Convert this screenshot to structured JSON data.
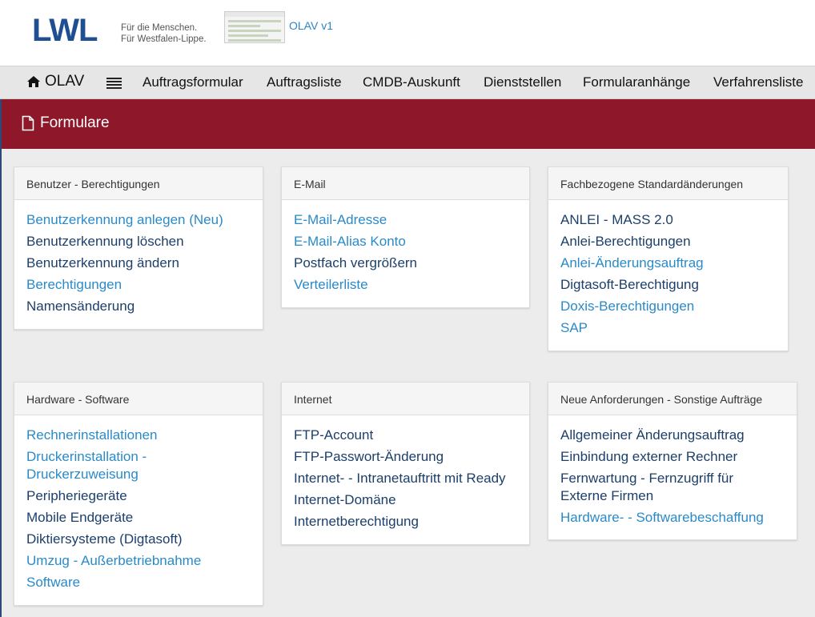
{
  "header": {
    "logo_text": "LWL",
    "tagline_line1": "Für die Menschen.",
    "tagline_line2": "Für Westfalen-Lippe.",
    "app_version": "OLAV v1"
  },
  "nav": {
    "home_label": "OLAV",
    "items": [
      "Auftragsformular",
      "Auftragsliste",
      "CMDB-Auskunft",
      "Dienststellen",
      "Formularanhänge",
      "Verfahrensliste"
    ]
  },
  "page": {
    "title": "Formulare"
  },
  "colors": {
    "brand": "#8e1829",
    "link_light": "#2a8ac8",
    "link_dark": "#1c3f6a",
    "logo": "#1d4f91"
  },
  "cards": [
    {
      "title": "Benutzer - Berechtigungen",
      "links": [
        {
          "label": "Benutzerkennung anlegen (Neu)",
          "style": "light"
        },
        {
          "label": "Benutzerkennung löschen",
          "style": "dark"
        },
        {
          "label": "Benutzerkennung ändern",
          "style": "dark"
        },
        {
          "label": "Berechtigungen",
          "style": "light"
        },
        {
          "label": "Namensänderung",
          "style": "dark"
        }
      ]
    },
    {
      "title": "E-Mail",
      "links": [
        {
          "label": "E-Mail-Adresse",
          "style": "light"
        },
        {
          "label": "E-Mail-Alias Konto",
          "style": "light"
        },
        {
          "label": "Postfach vergrößern",
          "style": "dark"
        },
        {
          "label": "Verteilerliste",
          "style": "light"
        }
      ]
    },
    {
      "title": "Fachbezogene Standardänderungen",
      "links": [
        {
          "label": "ANLEI - MASS 2.0",
          "style": "dark"
        },
        {
          "label": "Anlei-Berechtigungen",
          "style": "dark"
        },
        {
          "label": "Anlei-Änderungsauftrag",
          "style": "light"
        },
        {
          "label": "Digtasoft-Berechtigung",
          "style": "dark"
        },
        {
          "label": "Doxis-Berechtigungen",
          "style": "light"
        },
        {
          "label": "SAP",
          "style": "light"
        }
      ]
    },
    {
      "title": "Hardware - Software",
      "links": [
        {
          "label": "Rechnerinstallationen",
          "style": "light"
        },
        {
          "label": "Druckerinstallation - Druckerzuweisung",
          "style": "light"
        },
        {
          "label": "Peripheriegeräte",
          "style": "dark"
        },
        {
          "label": "Mobile Endgeräte",
          "style": "dark"
        },
        {
          "label": "Diktiersysteme (Digtasoft)",
          "style": "dark"
        },
        {
          "label": "Umzug - Außerbetriebnahme",
          "style": "light"
        },
        {
          "label": "Software",
          "style": "light"
        }
      ]
    },
    {
      "title": "Internet",
      "links": [
        {
          "label": "FTP-Account",
          "style": "dark"
        },
        {
          "label": "FTP-Passwort-Änderung",
          "style": "dark"
        },
        {
          "label": "Internet- - Intranetauftritt mit Ready",
          "style": "dark"
        },
        {
          "label": "Internet-Domäne",
          "style": "dark"
        },
        {
          "label": "Internetberechtigung",
          "style": "dark"
        }
      ]
    },
    {
      "title": "Neue Anforderungen - Sonstige Aufträge",
      "links": [
        {
          "label": "Allgemeiner Änderungsauftrag",
          "style": "dark"
        },
        {
          "label": "Einbindung externer Rechner",
          "style": "dark"
        },
        {
          "label": "Fernwartung - Fernzugriff für Externe Firmen",
          "style": "dark"
        },
        {
          "label": "Hardware- - Softwarebeschaffung",
          "style": "light"
        }
      ]
    }
  ]
}
